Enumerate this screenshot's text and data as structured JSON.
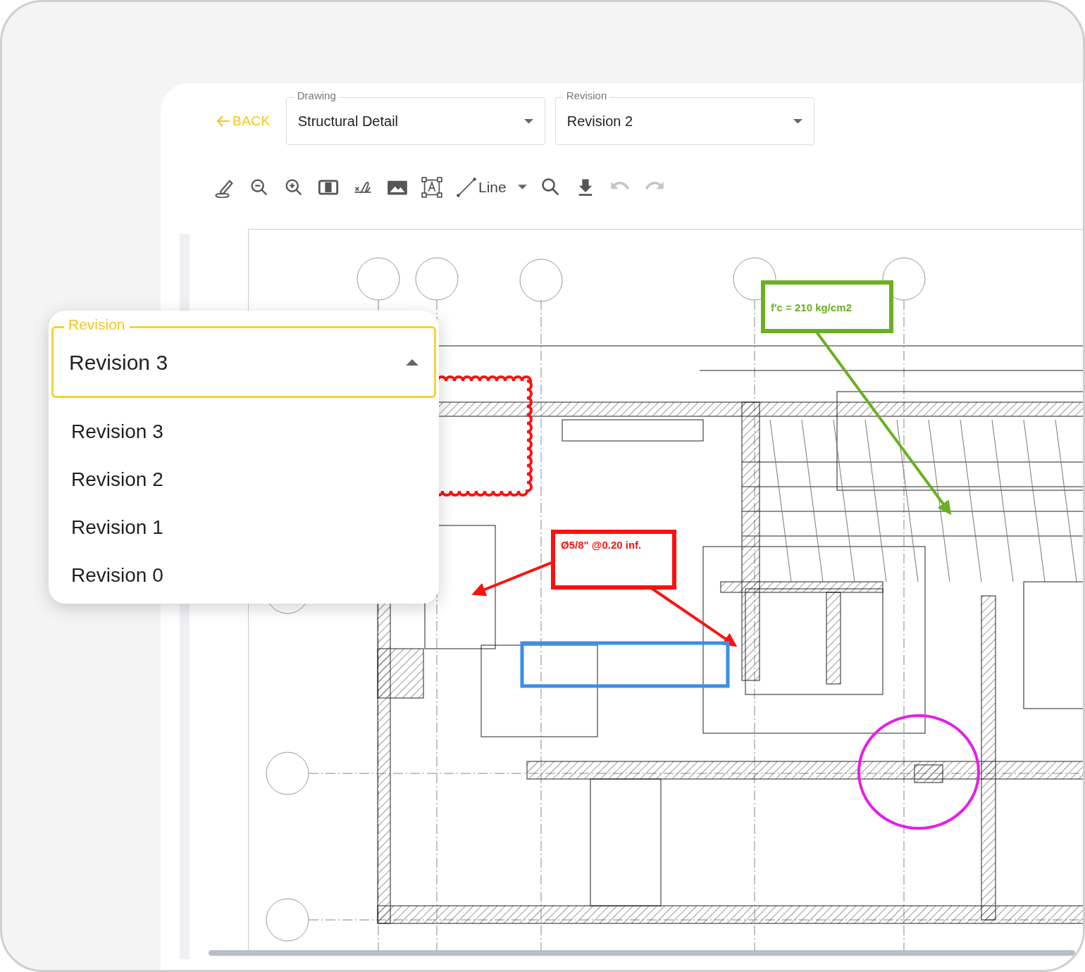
{
  "header": {
    "back": "BACK",
    "drawing_select": {
      "label": "Drawing",
      "value": "Structural Detail"
    },
    "revision_select": {
      "label": "Revision",
      "value": "Revision 2"
    }
  },
  "toolbar": [
    {
      "kind": "pen",
      "disabled": false
    },
    {
      "kind": "zoom-out",
      "disabled": false
    },
    {
      "kind": "zoom-in",
      "disabled": false
    },
    {
      "kind": "compare",
      "disabled": false
    },
    {
      "kind": "signature",
      "disabled": false
    },
    {
      "kind": "image",
      "disabled": false
    },
    {
      "kind": "text-box",
      "disabled": false
    },
    {
      "kind": "line",
      "label": "Line",
      "disabled": false
    },
    {
      "kind": "search",
      "disabled": false
    },
    {
      "kind": "download",
      "disabled": false
    },
    {
      "kind": "undo",
      "disabled": true
    },
    {
      "kind": "redo",
      "disabled": true
    }
  ],
  "markups": [
    {
      "kind": "callout",
      "color": "#6ab023",
      "text": "f'c = 210 kg/cm2"
    },
    {
      "kind": "callout",
      "color": "#ff1010",
      "text": "Ø5/8\" @0.20 inf."
    },
    {
      "kind": "rectangle",
      "color": "#3b8ee8"
    },
    {
      "kind": "cloud",
      "color": "#ff1010"
    },
    {
      "kind": "ellipse",
      "color": "#e61ee6"
    }
  ],
  "revision_dropdown": {
    "label": "Revision",
    "value": "Revision 3",
    "expanded": true,
    "options": [
      "Revision 3",
      "Revision 2",
      "Revision 1",
      "Revision 0"
    ]
  }
}
